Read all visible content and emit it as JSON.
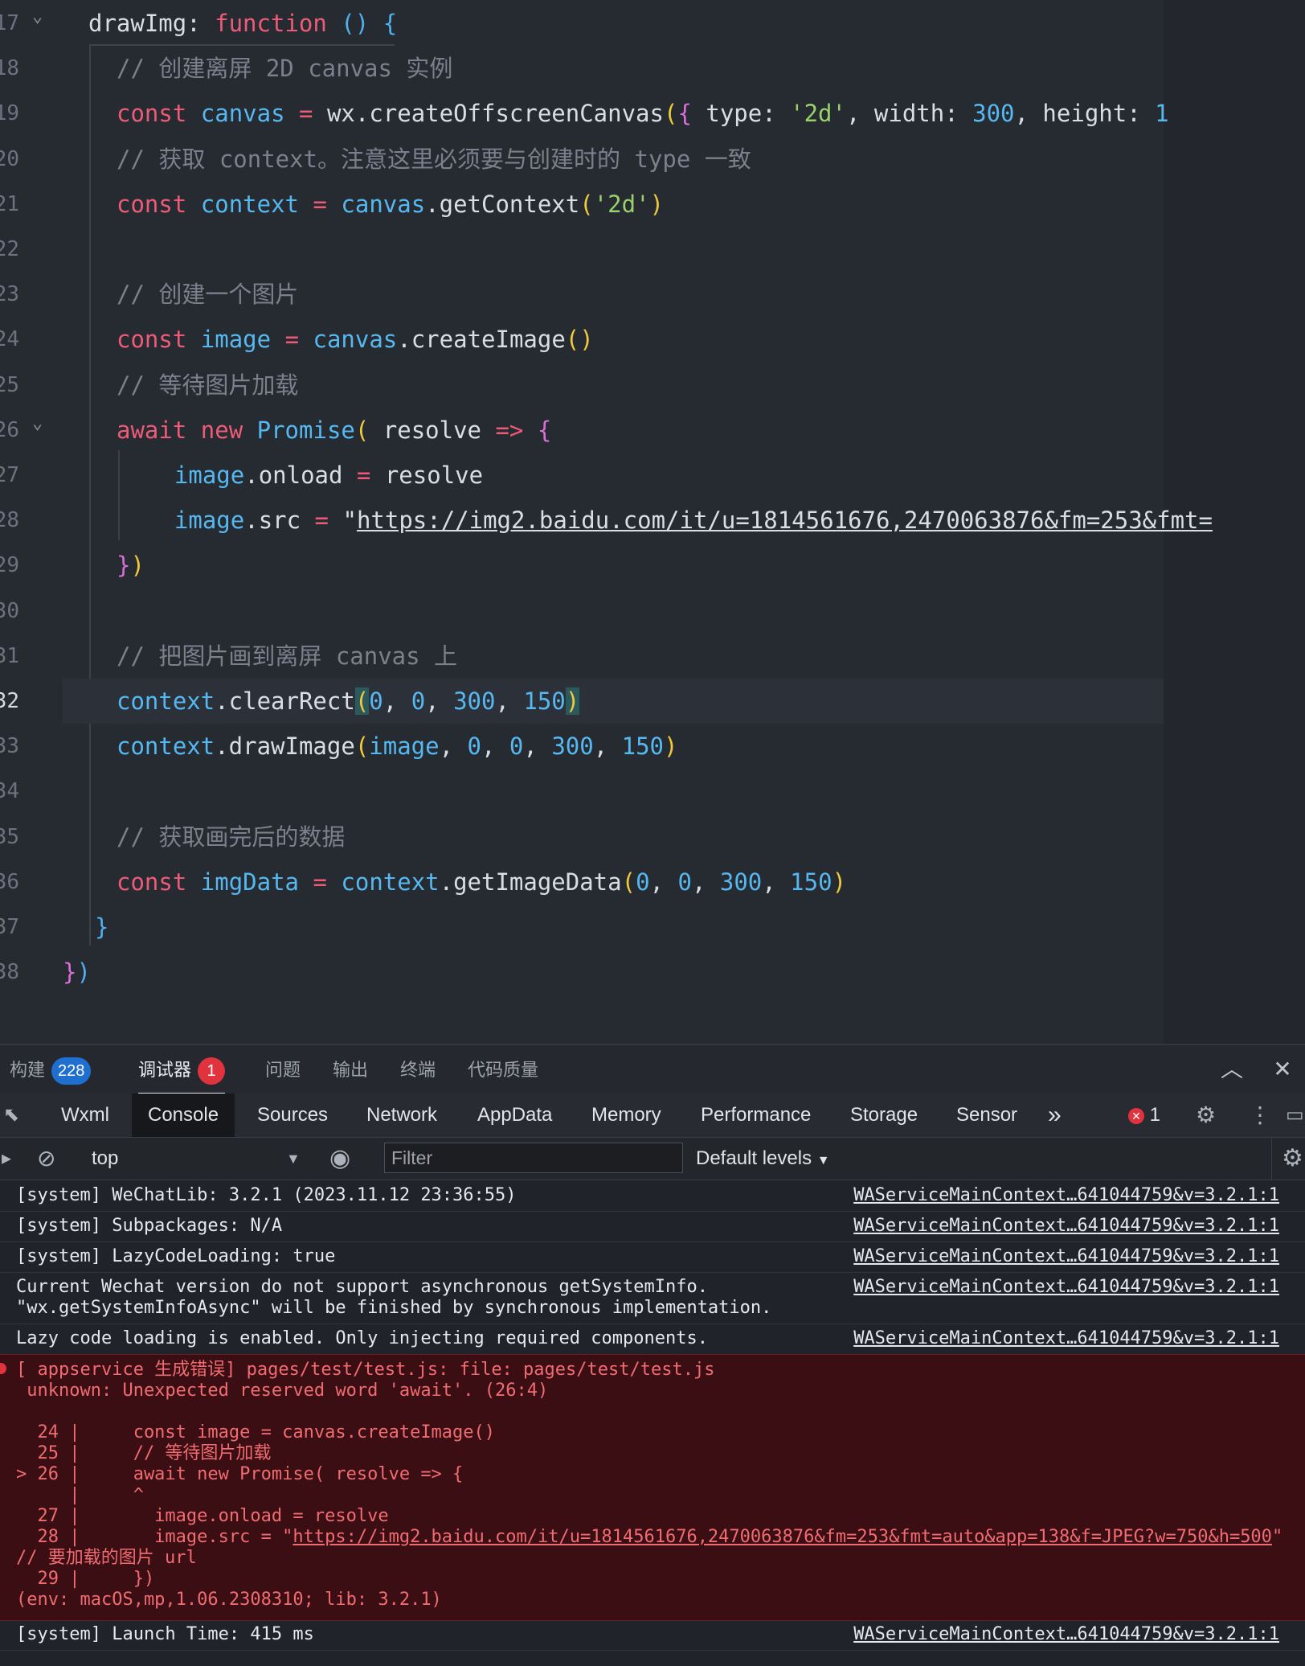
{
  "editor": {
    "lines": [
      {
        "n": "17",
        "fold": true,
        "active": false,
        "tokens": [
          [
            "fn",
            "drawImg"
          ],
          [
            "fn",
            ": "
          ],
          [
            "kw",
            "function"
          ],
          [
            "fn",
            " "
          ],
          [
            "p3",
            "()"
          ],
          [
            "fn",
            " "
          ],
          [
            "p3",
            "{"
          ]
        ]
      },
      {
        "n": "18",
        "active": false,
        "tokens": [
          [
            "com",
            "// 创建离屏 2D canvas 实例"
          ]
        ]
      },
      {
        "n": "19",
        "active": false,
        "tokens": [
          [
            "kw",
            "const"
          ],
          [
            "fn",
            " "
          ],
          [
            "var",
            "canvas"
          ],
          [
            "fn",
            " "
          ],
          [
            "kw",
            "="
          ],
          [
            "fn",
            " wx.createOffscreenCanvas"
          ],
          [
            "p1",
            "("
          ],
          [
            "p2",
            "{"
          ],
          [
            "fn",
            " type: "
          ],
          [
            "str",
            "'2d'"
          ],
          [
            "fn",
            ", width: "
          ],
          [
            "num",
            "300"
          ],
          [
            "fn",
            ", height: "
          ],
          [
            "num",
            "1"
          ]
        ]
      },
      {
        "n": "20",
        "active": false,
        "tokens": [
          [
            "com",
            "// 获取 context。注意这里必须要与创建时的 type 一致"
          ]
        ]
      },
      {
        "n": "21",
        "active": false,
        "tokens": [
          [
            "kw",
            "const"
          ],
          [
            "fn",
            " "
          ],
          [
            "var",
            "context"
          ],
          [
            "fn",
            " "
          ],
          [
            "kw",
            "="
          ],
          [
            "fn",
            " "
          ],
          [
            "var",
            "canvas"
          ],
          [
            "fn",
            ".getContext"
          ],
          [
            "p1",
            "("
          ],
          [
            "str",
            "'2d'"
          ],
          [
            "p1",
            ")"
          ]
        ]
      },
      {
        "n": "22",
        "active": false,
        "tokens": []
      },
      {
        "n": "23",
        "active": false,
        "tokens": [
          [
            "com",
            "// 创建一个图片"
          ]
        ]
      },
      {
        "n": "24",
        "active": false,
        "tokens": [
          [
            "kw",
            "const"
          ],
          [
            "fn",
            " "
          ],
          [
            "var",
            "image"
          ],
          [
            "fn",
            " "
          ],
          [
            "kw",
            "="
          ],
          [
            "fn",
            " "
          ],
          [
            "var",
            "canvas"
          ],
          [
            "fn",
            ".createImage"
          ],
          [
            "p1",
            "()"
          ]
        ]
      },
      {
        "n": "25",
        "active": false,
        "tokens": [
          [
            "com",
            "// 等待图片加载"
          ]
        ]
      },
      {
        "n": "26",
        "fold": true,
        "active": false,
        "tokens": [
          [
            "kw",
            "await"
          ],
          [
            "fn",
            " "
          ],
          [
            "kw",
            "new"
          ],
          [
            "fn",
            " "
          ],
          [
            "var",
            "Promise"
          ],
          [
            "p1",
            "("
          ],
          [
            "fn",
            " resolve "
          ],
          [
            "kw",
            "=>"
          ],
          [
            "fn",
            " "
          ],
          [
            "p2",
            "{"
          ]
        ]
      },
      {
        "n": "27",
        "active": false,
        "tokens": [
          [
            "fn",
            "  "
          ],
          [
            "var",
            "image"
          ],
          [
            "fn",
            ".onload "
          ],
          [
            "kw",
            "="
          ],
          [
            "fn",
            " resolve"
          ]
        ]
      },
      {
        "n": "28",
        "active": false,
        "tokens": [
          [
            "fn",
            "  "
          ],
          [
            "var",
            "image"
          ],
          [
            "fn",
            ".src "
          ],
          [
            "kw",
            "="
          ],
          [
            "fn",
            " \""
          ],
          [
            "link",
            "https://img2.baidu.com/it/u=1814561676,2470063876&fm=253&fmt="
          ]
        ]
      },
      {
        "n": "29",
        "active": false,
        "tokens": [
          [
            "p2",
            "}"
          ],
          [
            "p1",
            ")"
          ]
        ]
      },
      {
        "n": "30",
        "active": false,
        "tokens": []
      },
      {
        "n": "31",
        "active": false,
        "tokens": [
          [
            "com",
            "// 把图片画到离屏 canvas 上"
          ]
        ]
      },
      {
        "n": "32",
        "active": true,
        "tokens": [
          [
            "var",
            "context"
          ],
          [
            "fn",
            ".clearRect"
          ],
          [
            "hl",
            "("
          ],
          [
            "num",
            "0"
          ],
          [
            "fn",
            ", "
          ],
          [
            "num",
            "0"
          ],
          [
            "fn",
            ", "
          ],
          [
            "num",
            "300"
          ],
          [
            "fn",
            ", "
          ],
          [
            "num",
            "150"
          ],
          [
            "hl",
            ")"
          ]
        ]
      },
      {
        "n": "33",
        "active": false,
        "tokens": [
          [
            "var",
            "context"
          ],
          [
            "fn",
            ".drawImage"
          ],
          [
            "p1",
            "("
          ],
          [
            "var",
            "image"
          ],
          [
            "fn",
            ", "
          ],
          [
            "num",
            "0"
          ],
          [
            "fn",
            ", "
          ],
          [
            "num",
            "0"
          ],
          [
            "fn",
            ", "
          ],
          [
            "num",
            "300"
          ],
          [
            "fn",
            ", "
          ],
          [
            "num",
            "150"
          ],
          [
            "p1",
            ")"
          ]
        ]
      },
      {
        "n": "34",
        "active": false,
        "tokens": []
      },
      {
        "n": "35",
        "active": false,
        "tokens": [
          [
            "com",
            "// 获取画完后的数据"
          ]
        ]
      },
      {
        "n": "36",
        "active": false,
        "tokens": [
          [
            "kw",
            "const"
          ],
          [
            "fn",
            " "
          ],
          [
            "var",
            "imgData"
          ],
          [
            "fn",
            " "
          ],
          [
            "kw",
            "="
          ],
          [
            "fn",
            " "
          ],
          [
            "var",
            "context"
          ],
          [
            "fn",
            ".getImageData"
          ],
          [
            "p1",
            "("
          ],
          [
            "num",
            "0"
          ],
          [
            "fn",
            ", "
          ],
          [
            "num",
            "0"
          ],
          [
            "fn",
            ", "
          ],
          [
            "num",
            "300"
          ],
          [
            "fn",
            ", "
          ],
          [
            "num",
            "150"
          ],
          [
            "p1",
            ")"
          ]
        ]
      },
      {
        "n": "37",
        "active": false,
        "tokens": [
          [
            "p3",
            "}"
          ]
        ]
      },
      {
        "n": "38",
        "active": false,
        "tokens": [
          [
            "p2",
            "}"
          ],
          [
            "p3",
            ")"
          ]
        ]
      }
    ]
  },
  "panel": {
    "tabs": [
      {
        "label": "构建",
        "badge": "228",
        "badge_color": "blue",
        "active": false
      },
      {
        "label": "调试器",
        "badge": "1",
        "badge_color": "red",
        "active": true
      },
      {
        "label": "问题",
        "active": false
      },
      {
        "label": "输出",
        "active": false
      },
      {
        "label": "终端",
        "active": false
      },
      {
        "label": "代码质量",
        "active": false
      }
    ],
    "collapse_icon": "chevron-up-icon",
    "close_icon": "close-icon"
  },
  "devtools": {
    "tabs": [
      "Wxml",
      "Console",
      "Sources",
      "Network",
      "AppData",
      "Memory",
      "Performance",
      "Storage",
      "Sensor"
    ],
    "active_tab": "Console",
    "more": "»",
    "error_count": "1",
    "context": "top",
    "filter_placeholder": "Filter",
    "levels": "Default levels"
  },
  "console": {
    "messages": [
      {
        "text": "[system] WeChatLib: 3.2.1 (2023.11.12 23:36:55)",
        "source": "WAServiceMainContext…641044759&v=3.2.1:1"
      },
      {
        "text": "[system] Subpackages: N/A",
        "source": "WAServiceMainContext…641044759&v=3.2.1:1"
      },
      {
        "text": "[system] LazyCodeLoading: true",
        "source": "WAServiceMainContext…641044759&v=3.2.1:1"
      },
      {
        "text": "Current Wechat version do not support asynchronous getSystemInfo.\n\"wx.getSystemInfoAsync\" will be finished by synchronous implementation.",
        "source": "WAServiceMainContext…641044759&v=3.2.1:1"
      },
      {
        "text": "Lazy code loading is enabled. Only injecting required components.",
        "source": "WAServiceMainContext…641044759&v=3.2.1:1"
      }
    ],
    "error": {
      "lines": [
        "[ appservice 生成错误] pages/test/test.js: file: pages/test/test.js",
        " unknown: Unexpected reserved word 'await'. (26:4)",
        "",
        "  24 |     const image = canvas.createImage()",
        "  25 |     // 等待图片加载",
        "> 26 |     await new Promise( resolve => {",
        "     |     ^",
        "  27 |       image.onload = resolve",
        "  28 |       image.src = \"",
        "// 要加载的图片 url",
        "  29 |     })",
        "(env: macOS,mp,1.06.2308310; lib: 3.2.1)"
      ],
      "link": "https://img2.baidu.com/it/u=1814561676,2470063876&fm=253&fmt=auto&app=138&f=JPEG?w=750&h=500",
      "link_suffix": "\""
    },
    "last": {
      "text": "[system] Launch Time: 415 ms",
      "source": "WAServiceMainContext…641044759&v=3.2.1:1"
    }
  }
}
